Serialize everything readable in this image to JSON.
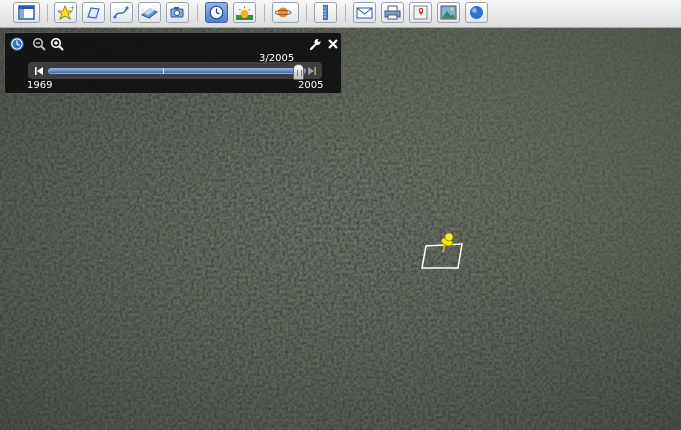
{
  "toolbar": {
    "buttons": [
      {
        "name": "sidebar-toggle-button",
        "icon": "sidebar-icon"
      },
      {
        "name": "add-placemark-button",
        "icon": "placemark-star-icon"
      },
      {
        "name": "add-polygon-button",
        "icon": "polygon-icon"
      },
      {
        "name": "add-path-button",
        "icon": "path-icon"
      },
      {
        "name": "add-image-overlay-button",
        "icon": "image-overlay-icon"
      },
      {
        "name": "record-tour-button",
        "icon": "record-tour-icon"
      },
      {
        "name": "historical-imagery-button",
        "icon": "clock-icon",
        "active": true
      },
      {
        "name": "sunlight-button",
        "icon": "sunrise-icon"
      },
      {
        "name": "switch-planet-button",
        "icon": "planet-icon"
      },
      {
        "name": "ruler-button",
        "icon": "ruler-icon"
      },
      {
        "name": "email-button",
        "icon": "envelope-icon"
      },
      {
        "name": "print-button",
        "icon": "printer-icon"
      },
      {
        "name": "view-in-maps-button",
        "icon": "map-icon"
      },
      {
        "name": "save-image-button",
        "icon": "picture-icon"
      },
      {
        "name": "earth-gallery-button",
        "icon": "globe-icon"
      }
    ]
  },
  "time_slider": {
    "current_date": "3/2005",
    "start_year": "1969",
    "end_year": "2005",
    "position": 0.97
  },
  "colors": {
    "terrain": "#3f443b",
    "placemark": "#f2e600",
    "outline": "#ffffff",
    "track": "#4a74bd"
  }
}
